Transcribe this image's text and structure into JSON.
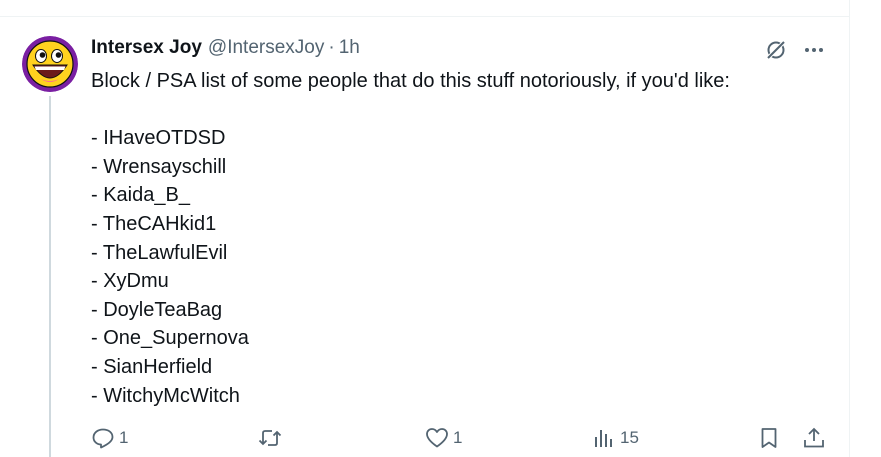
{
  "tweet": {
    "author_name": "Intersex Joy",
    "author_handle": "@IntersexJoy",
    "separator": "·",
    "time": "1h",
    "text_intro": "Block / PSA list of some people that do this stuff notoriously, if you'd like:",
    "list_items": [
      "- IHaveOTDSD",
      "- Wrensayschill",
      "- Kaida_B_",
      "- TheCAHkid1",
      "- TheLawfulEvil",
      "- XyDmu",
      "- DoyleTeaBag",
      "- One_Supernova",
      "- SianHerfield",
      "- WitchyMcWitch"
    ],
    "replies_count": "1",
    "likes_count": "1",
    "views_count": "15"
  },
  "icons": {
    "header": [
      "grok-icon",
      "more-icon"
    ],
    "actions": [
      "reply-icon",
      "retweet-icon",
      "like-icon",
      "views-icon",
      "bookmark-icon",
      "share-icon"
    ]
  },
  "colors": {
    "text_primary": "#0f1419",
    "text_secondary": "#536471",
    "thread_line": "#cfd9de",
    "divider": "#eff3f4",
    "avatar_background": "#7a1fa2",
    "avatar_face": "#ffd21f"
  }
}
